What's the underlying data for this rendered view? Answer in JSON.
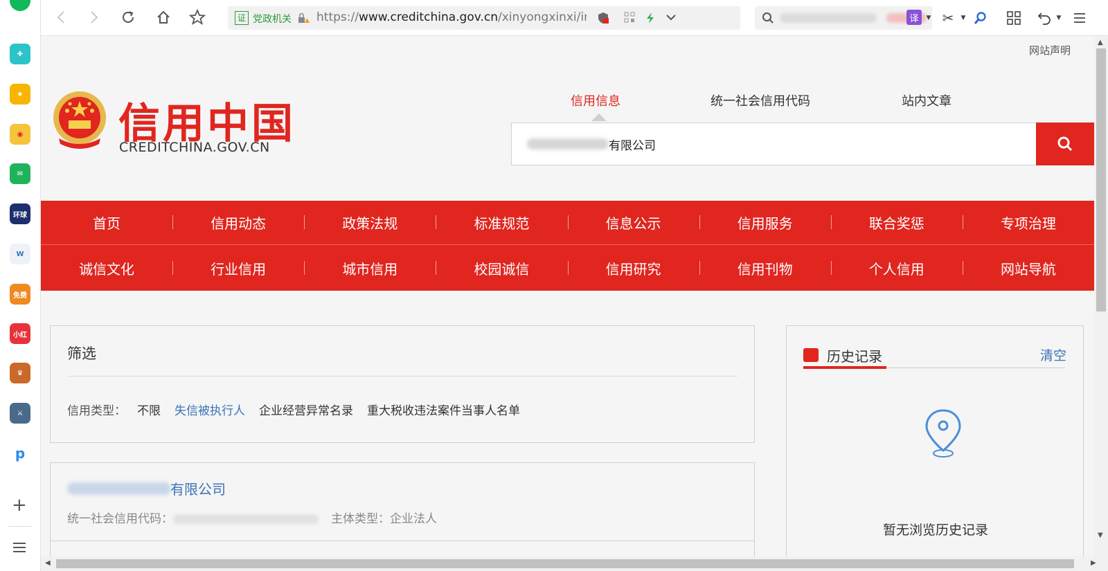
{
  "browser": {
    "cert_label": "证",
    "cert_org": "党政机关",
    "url_scheme": "https://",
    "url_host": "www.creditchina.gov.cn",
    "url_path": "/xinyongxinxi/ir",
    "translate_label": "译"
  },
  "header": {
    "statement": "网站声明",
    "logo_cn": "信用中国",
    "logo_en": "CREDITCHINA.GOV.CN"
  },
  "search": {
    "tabs": [
      "信用信息",
      "统一社会信用代码",
      "站内文章"
    ],
    "query_suffix": "有限公司"
  },
  "menu": {
    "row1": [
      "首页",
      "信用动态",
      "政策法规",
      "标准规范",
      "信息公示",
      "信用服务",
      "联合奖惩",
      "专项治理"
    ],
    "row2": [
      "诚信文化",
      "行业信用",
      "城市信用",
      "校园诚信",
      "信用研究",
      "信用刊物",
      "个人信用",
      "网站导航"
    ]
  },
  "filter": {
    "title": "筛选",
    "type_label": "信用类型：",
    "options": [
      "不限",
      "失信被执行人",
      "企业经营异常名录",
      "重大税收违法案件当事人名单"
    ]
  },
  "result": {
    "name_suffix": "有限公司",
    "code_label": "统一社会信用代码：",
    "subject_label": "主体类型：",
    "subject_value": "企业法人"
  },
  "history": {
    "title": "历史记录",
    "clear": "清空",
    "empty_text": "暂无浏览历史记录"
  },
  "colors": {
    "brand_red": "#e0261f",
    "link_blue": "#3a73b8",
    "cert_green": "#2e9a3a"
  }
}
